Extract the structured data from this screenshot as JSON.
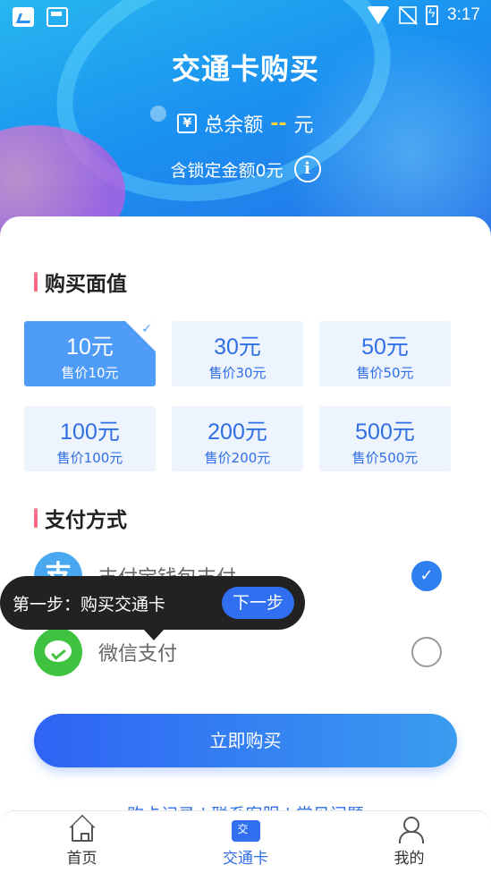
{
  "status_bar": {
    "time": "3:17"
  },
  "header": {
    "title": "交通卡购买",
    "balance_icon_text": "¥",
    "balance_label": "总余额",
    "balance_value": "--",
    "balance_unit": "元",
    "locked_text": "含锁定金额0元",
    "info_icon": "i"
  },
  "purchase": {
    "section_title": "购买面值",
    "options": [
      {
        "value": "10元",
        "price": "售价10元",
        "selected": true
      },
      {
        "value": "30元",
        "price": "售价30元",
        "selected": false
      },
      {
        "value": "50元",
        "price": "售价50元",
        "selected": false
      },
      {
        "value": "100元",
        "price": "售价100元",
        "selected": false
      },
      {
        "value": "200元",
        "price": "售价200元",
        "selected": false
      },
      {
        "value": "500元",
        "price": "售价500元",
        "selected": false
      }
    ]
  },
  "payment": {
    "section_title": "支付方式",
    "methods": [
      {
        "label": "支付宝钱包支付",
        "icon_text": "支",
        "selected": true
      },
      {
        "label": "微信支付",
        "selected": false
      }
    ]
  },
  "tooltip": {
    "text": "第一步：购买交通卡",
    "next_label": "下一步"
  },
  "buy_button": "立即购买",
  "footer_links": [
    "购卡记录",
    "联系客服",
    "常见问题"
  ],
  "tabs": [
    {
      "label": "首页",
      "active": false
    },
    {
      "label": "交通卡",
      "active": true
    },
    {
      "label": "我的",
      "active": false
    }
  ],
  "colors": {
    "accent": "#2f6fe5",
    "selected_option": "#4f9bf8",
    "wechat": "#3fc240",
    "alipay": "#4aa8f0"
  }
}
